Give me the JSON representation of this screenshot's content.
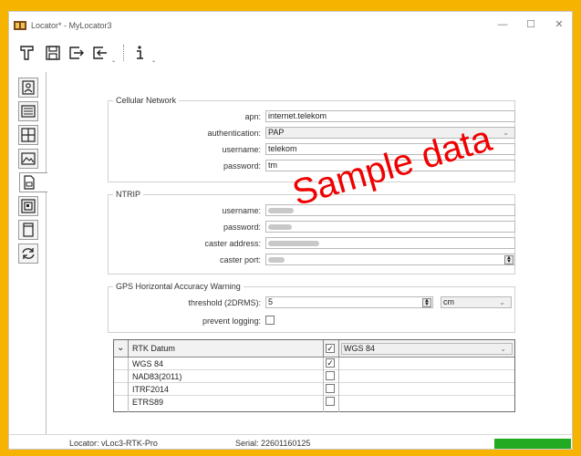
{
  "window": {
    "title": "Locator* - MyLocator3"
  },
  "toolbar": {
    "buttons": [
      "open-file-icon",
      "save-icon",
      "export-icon",
      "import-icon",
      "info-icon"
    ],
    "dropdown_arrow": "⌄"
  },
  "sidebar": {
    "items": [
      "contact-card-icon",
      "list-icon",
      "grid-icon",
      "image-icon",
      "document-icon",
      "frame-icon",
      "page-icon",
      "refresh-icon"
    ],
    "active_index": 4
  },
  "cellular": {
    "title": "Cellular Network",
    "apn_label": "apn:",
    "apn_value": "internet.telekom",
    "auth_label": "authentication:",
    "auth_value": "PAP",
    "username_label": "username:",
    "username_value": "telekom",
    "password_label": "password:",
    "password_value": "tm"
  },
  "ntrip": {
    "title": "NTRIP",
    "username_label": "username:",
    "password_label": "password:",
    "caster_address_label": "caster address:",
    "caster_port_label": "caster port:"
  },
  "gps": {
    "title": "GPS Horizontal Accuracy Warning",
    "threshold_label": "threshold (2DRMS):",
    "threshold_value": "5",
    "unit_value": "cm",
    "prevent_label": "prevent logging:",
    "prevent_checked": false
  },
  "datum_table": {
    "header_label": "RTK Datum",
    "header_checked": true,
    "selected_datum": "WGS 84",
    "rows": [
      {
        "name": "WGS 84",
        "checked": true
      },
      {
        "name": "NAD83(2011)",
        "checked": false
      },
      {
        "name": "ITRF2014",
        "checked": false
      },
      {
        "name": "ETRS89",
        "checked": false
      }
    ]
  },
  "watermark": "Sample data",
  "status": {
    "locator": "Locator: vLoc3-RTK-Pro",
    "serial": "Serial: 22601160125",
    "indicator_color": "#22aa22"
  },
  "colors": {
    "frame": "#f6b400",
    "watermark": "#f00000"
  }
}
